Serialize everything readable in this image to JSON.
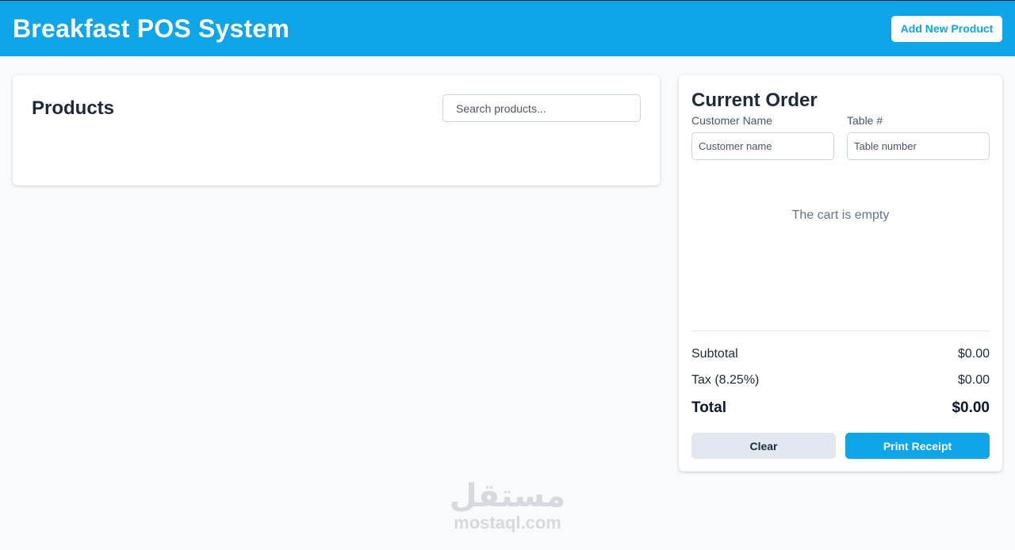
{
  "header": {
    "title": "Breakfast POS System",
    "add_product_label": "Add New Product"
  },
  "products": {
    "title": "Products",
    "search_placeholder": "Search products..."
  },
  "order": {
    "title": "Current Order",
    "customer_label": "Customer Name",
    "customer_placeholder": "Customer name",
    "table_label": "Table #",
    "table_placeholder": "Table number",
    "empty_message": "The cart is empty",
    "subtotal_label": "Subtotal",
    "subtotal_value": "$0.00",
    "tax_label": "Tax (8.25%)",
    "tax_value": "$0.00",
    "total_label": "Total",
    "total_value": "$0.00",
    "clear_label": "Clear",
    "print_label": "Print Receipt"
  },
  "watermark": {
    "arabic": "مستقل",
    "latin": "mostaql.com"
  },
  "colors": {
    "brand": "#0ea5e9",
    "background": "#f8fafc",
    "secondary_button": "#e2e8f0"
  }
}
